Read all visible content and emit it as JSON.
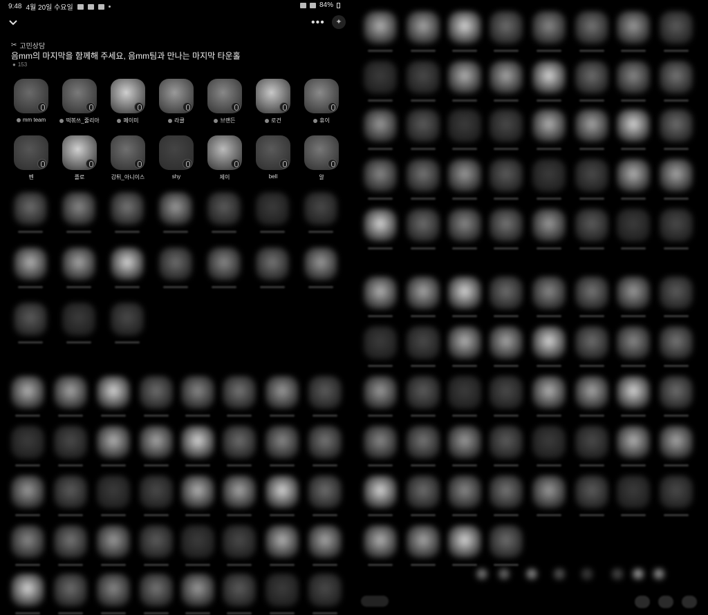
{
  "status_bar": {
    "time": "9:48",
    "date": "4월 20일 수요일",
    "battery": "84%"
  },
  "header": {
    "category": "고민상담",
    "title": "음mm의 마지막을 함께해 주세요, 음mm팀과 만나는 마지막 타운홀",
    "listener_count": "153"
  },
  "speakers": [
    {
      "label": "mm team",
      "has_dot": true
    },
    {
      "label": "떡볶쓰_줄리아",
      "has_dot": true
    },
    {
      "label": "페이미",
      "has_dot": true
    },
    {
      "label": "라클",
      "has_dot": true
    },
    {
      "label": "브랜든",
      "has_dot": true
    },
    {
      "label": "로건",
      "has_dot": true
    },
    {
      "label": "휴이",
      "has_dot": true
    },
    {
      "label": "벤",
      "has_dot": false
    },
    {
      "label": "플로",
      "has_dot": false
    },
    {
      "label": "감튀_아니이스",
      "has_dot": false
    },
    {
      "label": "shy",
      "has_dot": false
    },
    {
      "label": "제이",
      "has_dot": false
    },
    {
      "label": "bell",
      "has_dot": false
    },
    {
      "label": "알",
      "has_dot": false
    }
  ],
  "colors": {
    "background": "#000000",
    "text": "#f0f0f0"
  }
}
